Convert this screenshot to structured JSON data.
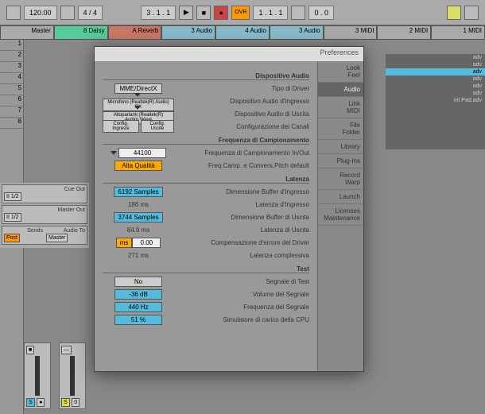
{
  "toolbar": {
    "tempo": "120.00",
    "sig": "4 / 4",
    "pos": "3 . 1 . 1",
    "play": "▶",
    "stop": "■",
    "rec": "●",
    "loop_start": "1 . 1 . 1",
    "loop_len": "0 . 0",
    "overdub": "OVR"
  },
  "tracks": [
    {
      "label": "Master",
      "cls": "gray"
    },
    {
      "label": "8 Daisy",
      "cls": "green"
    },
    {
      "label": "A Reverb",
      "cls": "red"
    },
    {
      "label": "3 Audio",
      "cls": "blue"
    },
    {
      "label": "4 Audio",
      "cls": "blue"
    },
    {
      "label": "3 Audio",
      "cls": "blue"
    },
    {
      "label": "3 MIDI",
      "cls": "gray"
    },
    {
      "label": "2 MIDI",
      "cls": "gray"
    },
    {
      "label": "1 MIDI",
      "cls": "gray"
    }
  ],
  "left_cells": [
    "1",
    "2",
    "3",
    "4",
    "5",
    "6",
    "7",
    "8"
  ],
  "mixer": {
    "cue_out": "Cue Out",
    "cue_route": "II 1/2",
    "master_out": "Master Out",
    "master_route": "II 1/2",
    "audio_to": "Audio To",
    "master_lbl": "Master",
    "sends": "Sends",
    "post_btn": "Post",
    "solo": "S",
    "rec": "●",
    "stop": "■",
    "dash": "—",
    "db": "0"
  },
  "browser": {
    "items": [
      "adv",
      "adv",
      "adv",
      "adv",
      "adv",
      "adv",
      "int Pad.adv"
    ],
    "selected_index": 2
  },
  "dialog": {
    "title": "Preferences",
    "tabs": [
      {
        "l1": "Look",
        "l2": "Feel"
      },
      {
        "l1": "Audio",
        "l2": ""
      },
      {
        "l1": "Link",
        "l2": "MIDI"
      },
      {
        "l1": "File",
        "l2": "Folder"
      },
      {
        "l1": "Library",
        "l2": ""
      },
      {
        "l1": "Plug-Ins",
        "l2": ""
      },
      {
        "l1": "Record",
        "l2": "Warp"
      },
      {
        "l1": "Launch",
        "l2": ""
      },
      {
        "l1": "Licenses",
        "l2": "Maintenance"
      }
    ],
    "active_tab": 1,
    "sections": {
      "audio_device": {
        "title": "Dispositivo Audio",
        "driver_type_label": "Tipo di Driver",
        "driver_type_value": "MME/DirectX",
        "input_device_label": "Dispositivo Audio d'Ingresso",
        "input_device_value": "Microfono (Realtek(R) Audio) DX",
        "output_device_label": "Dispositivo Audio di Uscita",
        "output_device_value": "Altoparlanti (Realtek(R) Audio) Wave",
        "channel_config_label": "Configurazione dei Canali",
        "config_in": "Config. Ingressi",
        "config_out": "Config. Uscite"
      },
      "sample_rate": {
        "title": "Frequenza di Campionamento",
        "rate_label": "Frequenza di Campionamento In/Out",
        "rate_value": "44100",
        "pitch_label": "Freq.Camp. e Convers.Pitch default",
        "pitch_value": "Alta Qualità"
      },
      "latency": {
        "title": "Latenza",
        "in_buf_label": "Dimensione Buffer d'Ingresso",
        "in_buf_value": "6192 Samples",
        "in_lat_label": "Latenza d'Ingresso",
        "in_lat_value": "186 ms",
        "out_buf_label": "Dimensione Buffer di Uscita",
        "out_buf_value": "3744 Samples",
        "out_lat_label": "Latenza di Uscita",
        "out_lat_value": "84.9 ms",
        "err_label": "Compensazione d'errore del Driver",
        "err_value": "0.00",
        "err_unit": "ms",
        "total_label": "Latenza complessiva",
        "total_value": "271 ms"
      },
      "test": {
        "title": "Test",
        "tone_label": "Segnale di Test",
        "tone_value": "No",
        "vol_label": "Volume del Segnale",
        "vol_value": "-36 dB",
        "freq_label": "Frequenza del Segnale",
        "freq_value": "440 Hz",
        "cpu_label": "Simulatore di carico della CPU",
        "cpu_value": "51 %"
      }
    }
  }
}
